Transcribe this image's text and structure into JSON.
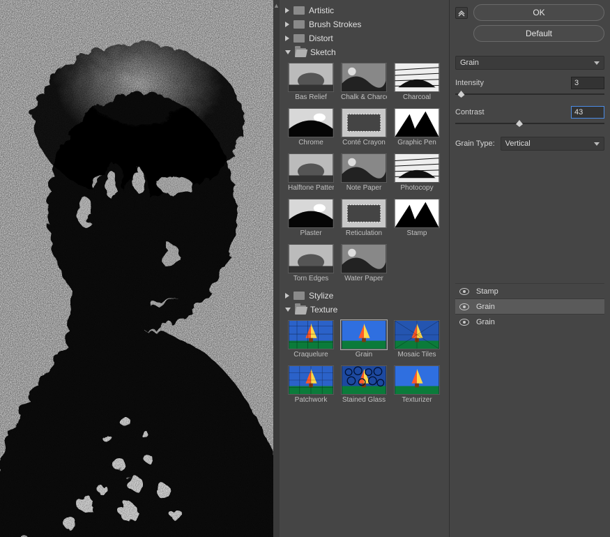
{
  "buttons": {
    "ok": "OK",
    "default": "Default"
  },
  "categories": {
    "artistic": "Artistic",
    "brush": "Brush Strokes",
    "distort": "Distort",
    "sketch": "Sketch",
    "stylize": "Stylize",
    "texture": "Texture"
  },
  "sketch_thumbs": [
    "Bas Relief",
    "Chalk & Charcoal",
    "Charcoal",
    "Chrome",
    "Conté Crayon",
    "Graphic Pen",
    "Halftone Pattern",
    "Note Paper",
    "Photocopy",
    "Plaster",
    "Reticulation",
    "Stamp",
    "Torn Edges",
    "Water Paper"
  ],
  "texture_thumbs": [
    "Craquelure",
    "Grain",
    "Mosaic Tiles",
    "Patchwork",
    "Stained Glass",
    "Texturizer"
  ],
  "selected_filter_label": "Grain",
  "params": {
    "intensity_label": "Intensity",
    "intensity_value": "3",
    "contrast_label": "Contrast",
    "contrast_value": "43",
    "grain_type_label": "Grain Type:",
    "grain_type_value": "Vertical"
  },
  "fx_stack": [
    {
      "name": "Stamp",
      "selected": false
    },
    {
      "name": "Grain",
      "selected": true
    },
    {
      "name": "Grain",
      "selected": false
    }
  ]
}
